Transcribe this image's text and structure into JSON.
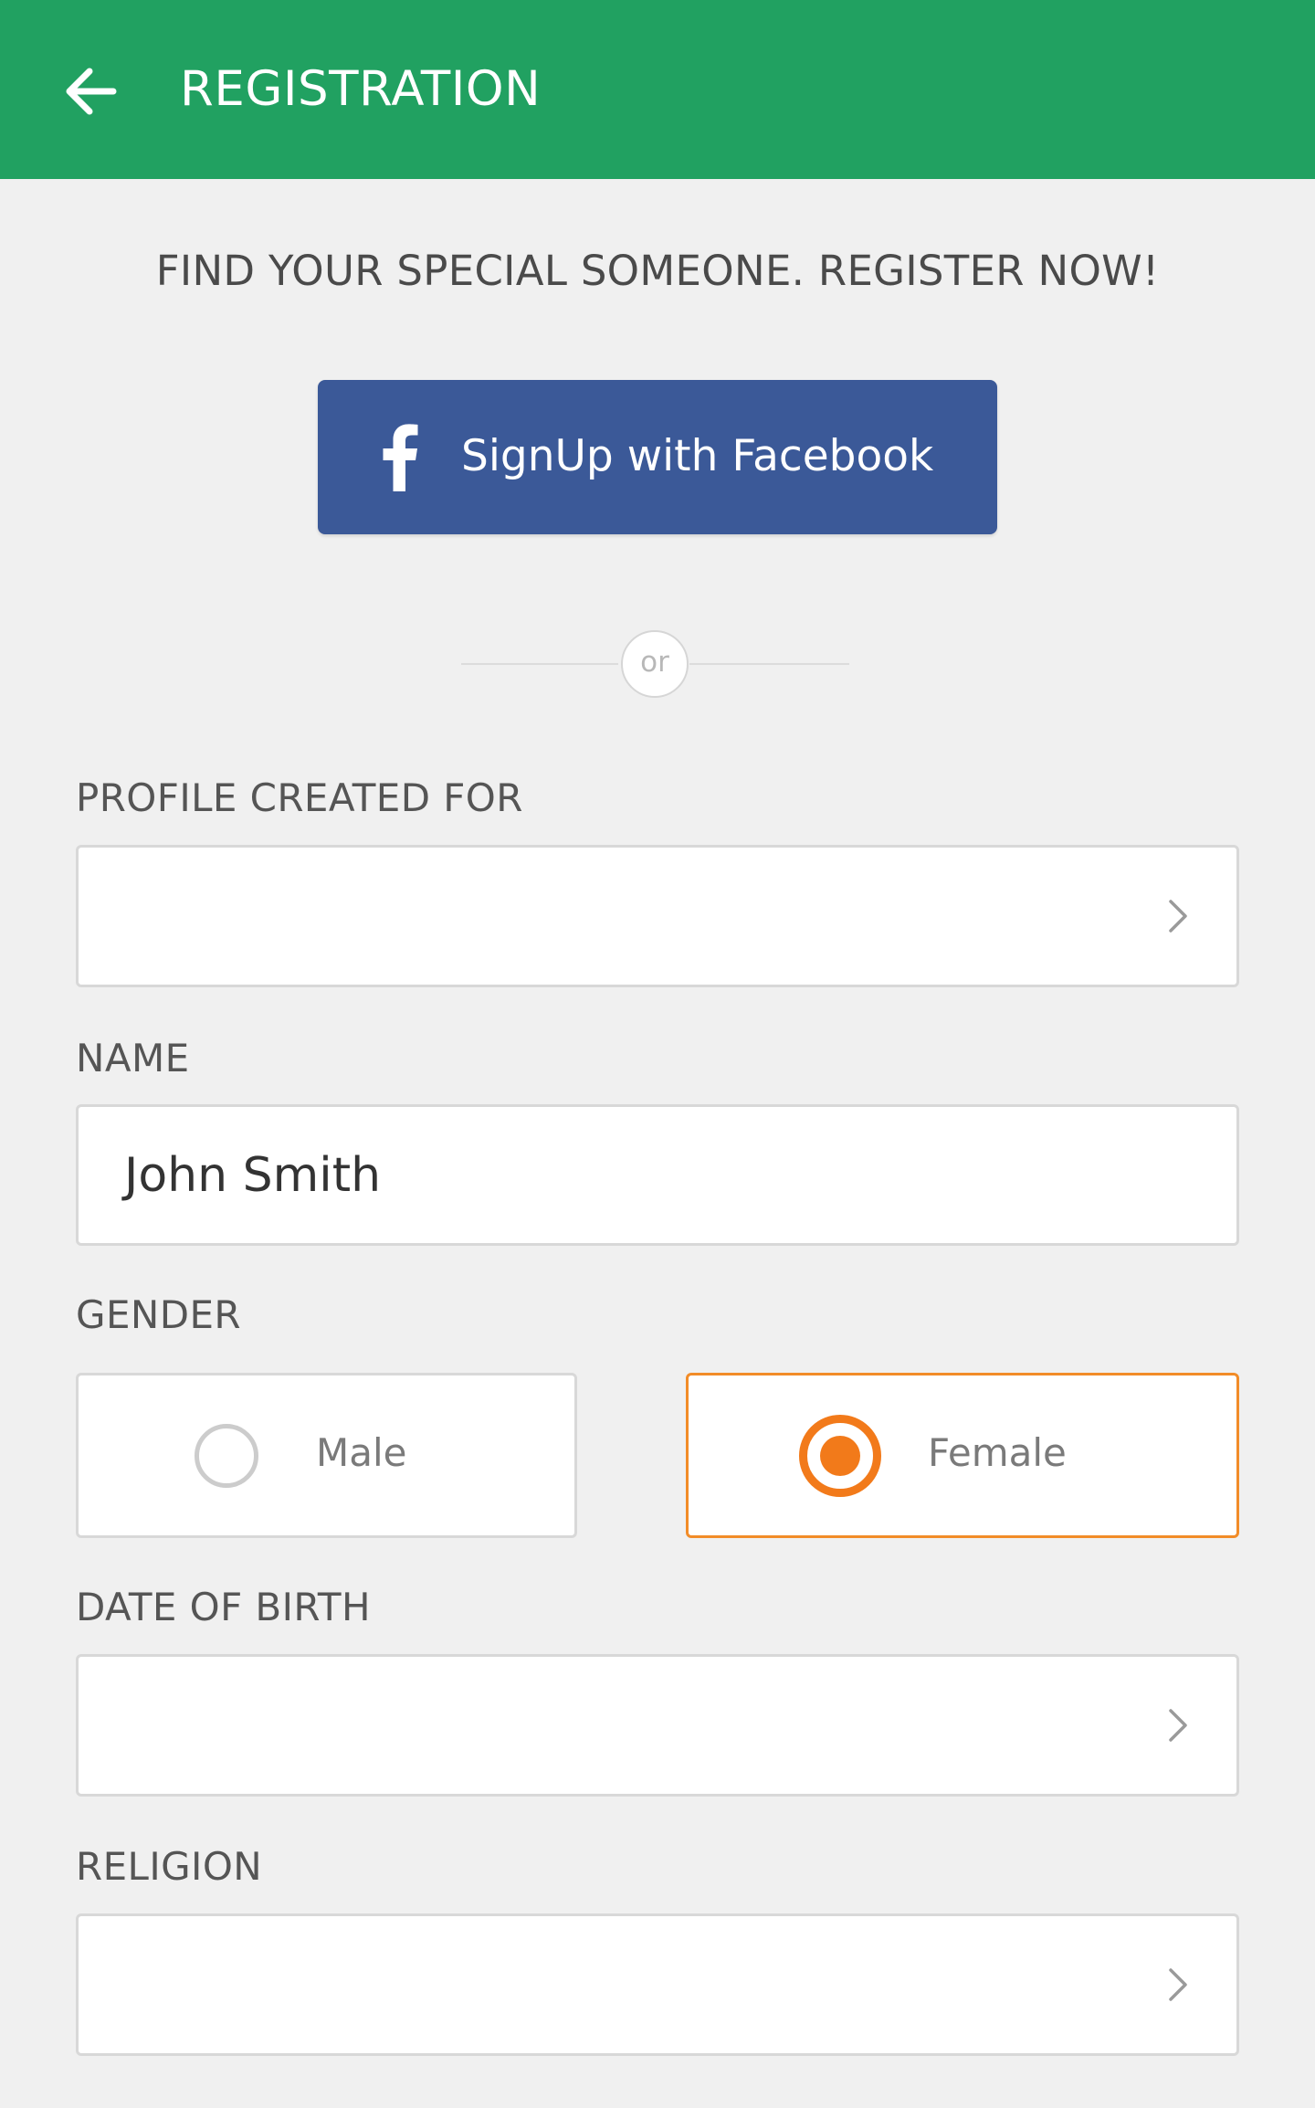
{
  "app_bar": {
    "title": "REGISTRATION",
    "back_icon": "arrow-left-icon",
    "background": "#21a161"
  },
  "tagline": "FIND YOUR SPECIAL SOMEONE. REGISTER NOW!",
  "facebook_button": {
    "icon": "facebook-icon",
    "label": "SignUp with Facebook",
    "background": "#3b5998"
  },
  "divider": {
    "text": "or"
  },
  "form": {
    "profile_created_for": {
      "label": "PROFILE CREATED FOR",
      "value": "",
      "icon": "chevron-right-icon"
    },
    "name": {
      "label": "NAME",
      "value": "John Smith"
    },
    "gender": {
      "label": "GENDER",
      "options": [
        {
          "label": "Male",
          "selected": false
        },
        {
          "label": "Female",
          "selected": true
        }
      ],
      "selected_color": "#f27a1a"
    },
    "date_of_birth": {
      "label": "DATE OF BIRTH",
      "value": "",
      "icon": "chevron-right-icon"
    },
    "religion": {
      "label": "RELIGION",
      "value": "",
      "icon": "chevron-right-icon"
    }
  }
}
